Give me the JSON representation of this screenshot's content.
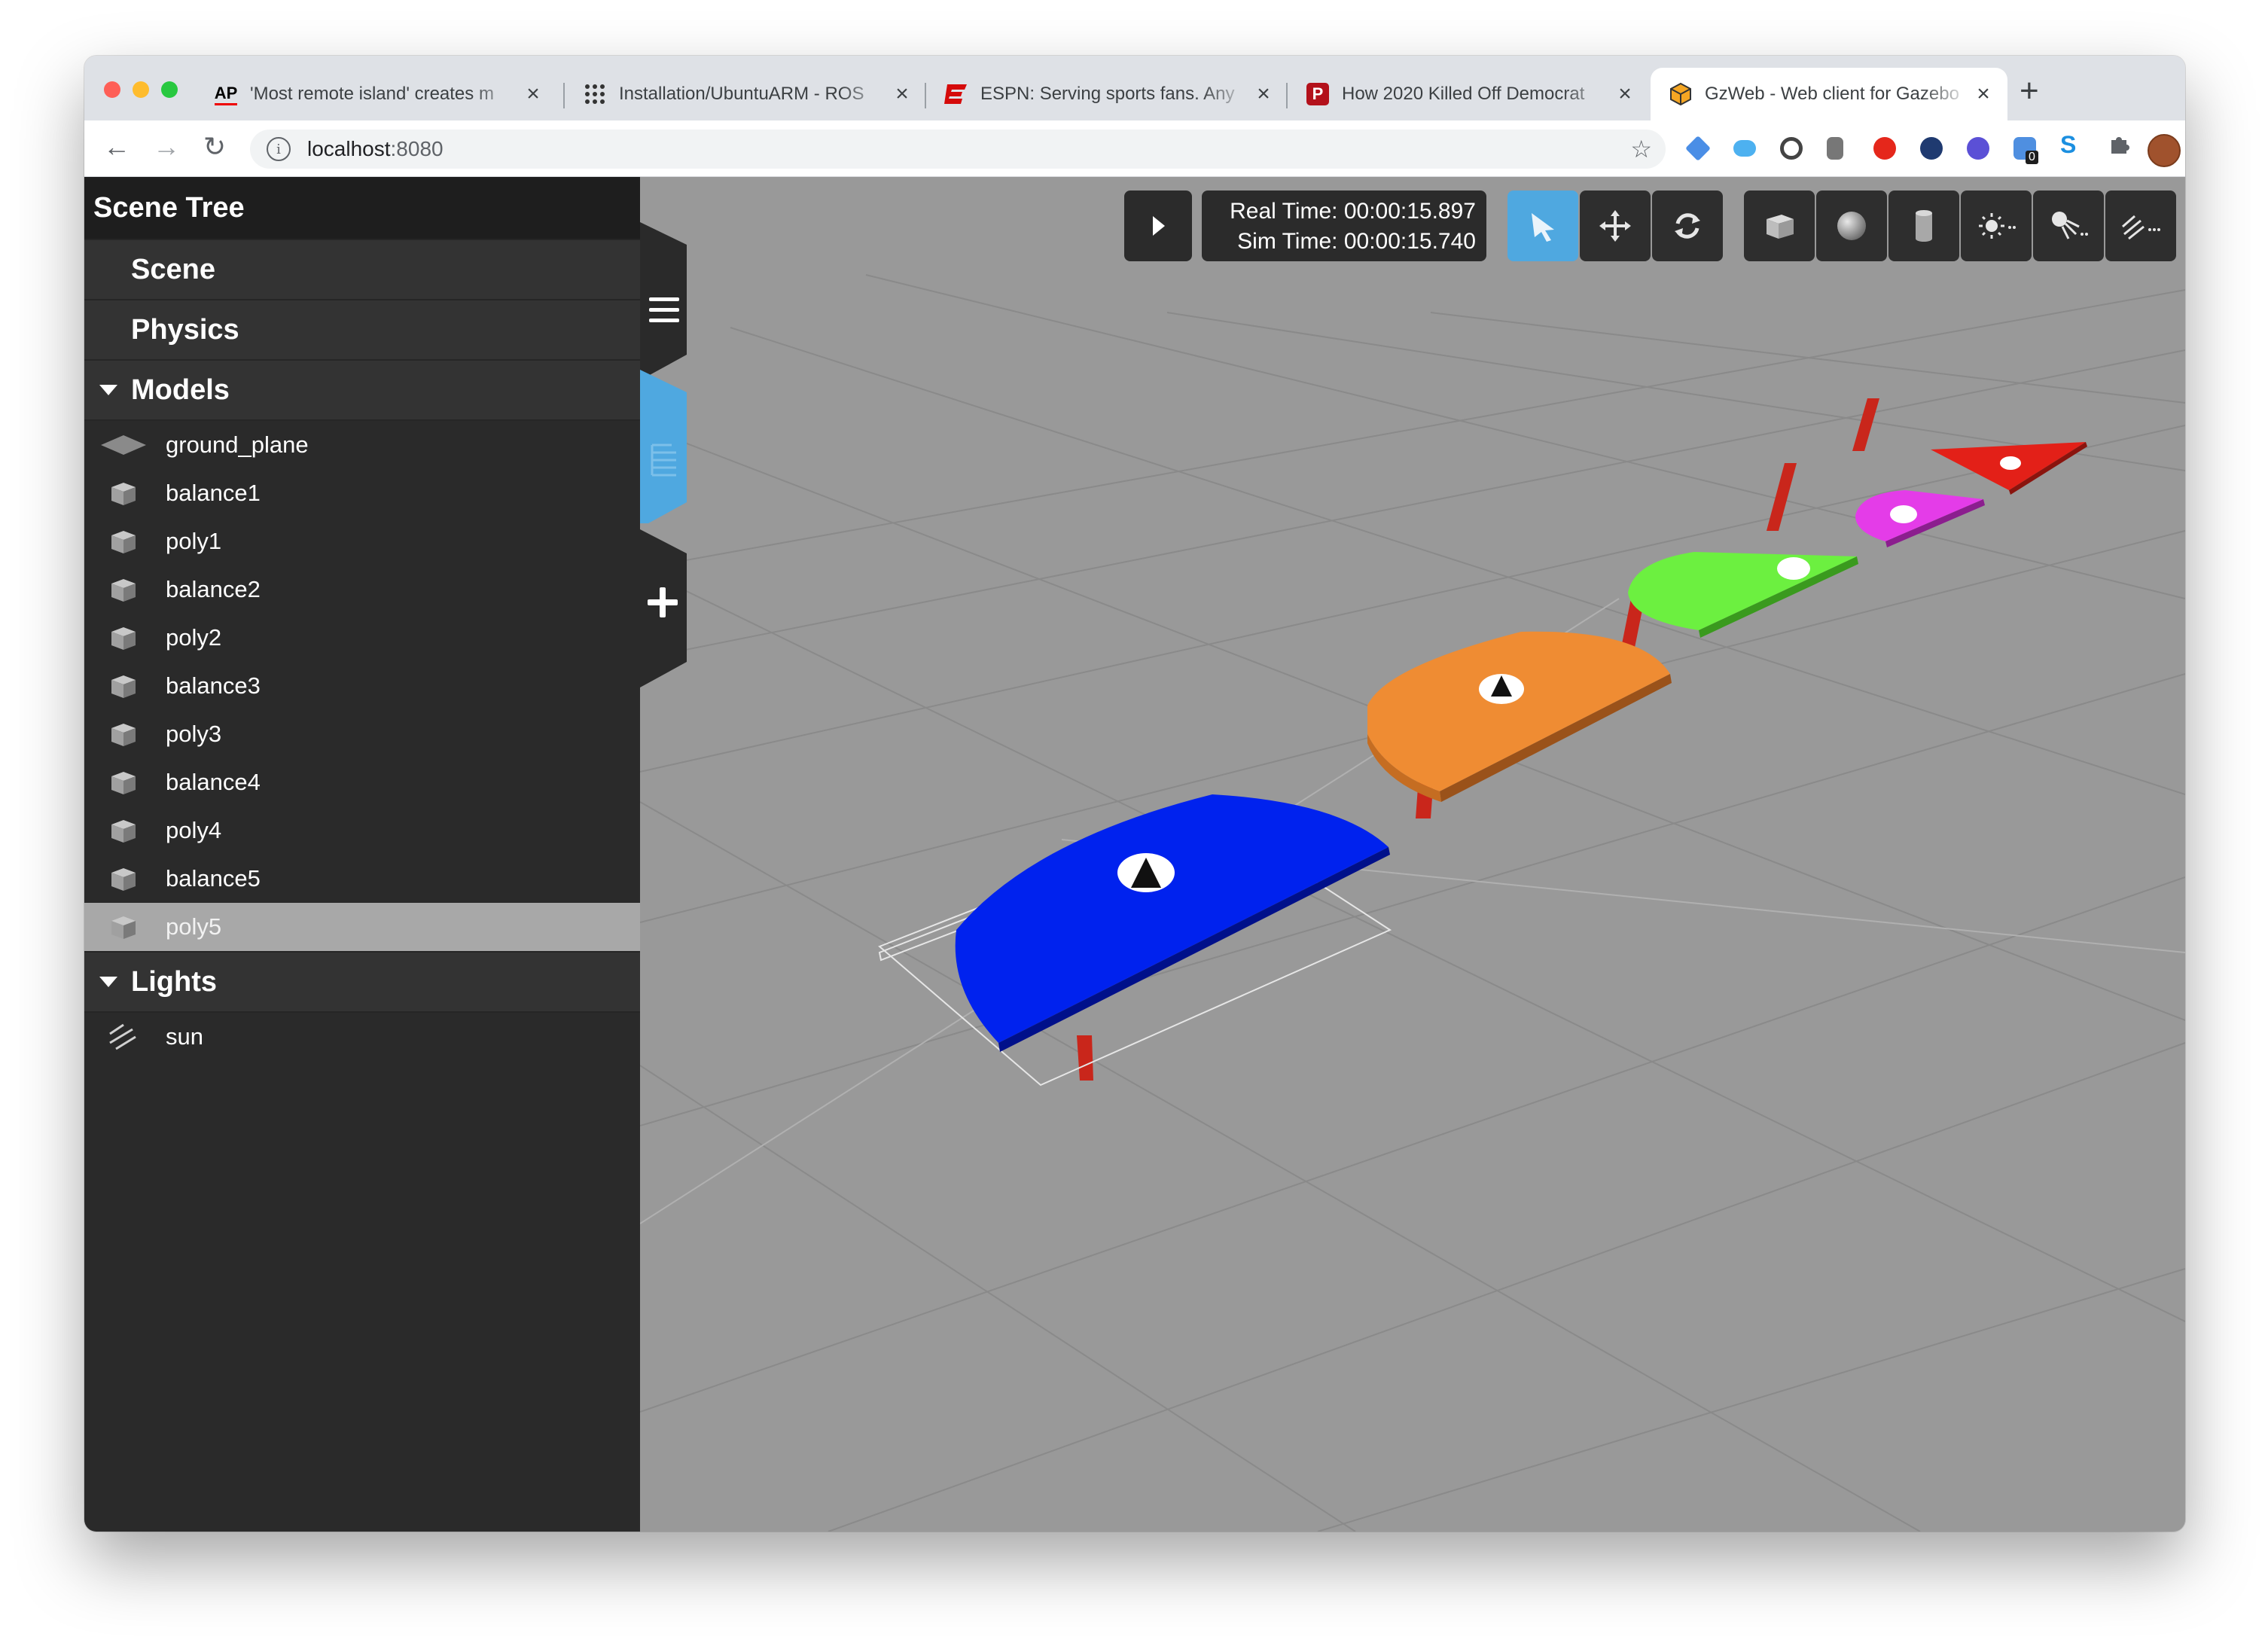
{
  "browser": {
    "tabs": [
      {
        "title": "'Most remote island' creates m",
        "favicon": "ap-icon",
        "active": false
      },
      {
        "title": "Installation/UbuntuARM - ROS",
        "favicon": "ros-grid-icon",
        "active": false
      },
      {
        "title": "ESPN: Serving sports fans. Any",
        "favicon": "espn-icon",
        "active": false
      },
      {
        "title": "How 2020 Killed Off Democrat",
        "favicon": "politico-icon",
        "active": false
      },
      {
        "title": "GzWeb - Web client for Gazebo",
        "favicon": "gazebo-icon",
        "active": true
      }
    ],
    "favicon_text": {
      "ap": "AP",
      "politico": "P"
    },
    "url_host": "localhost",
    "url_port": ":8080",
    "badge_count": "0"
  },
  "sidebar": {
    "title": "Scene Tree",
    "sections": [
      "Scene",
      "Physics"
    ],
    "models_label": "Models",
    "models": [
      {
        "label": "ground_plane",
        "icon": "plane-icon",
        "selected": false
      },
      {
        "label": "balance1",
        "icon": "box-icon",
        "selected": false
      },
      {
        "label": "poly1",
        "icon": "box-icon",
        "selected": false
      },
      {
        "label": "balance2",
        "icon": "box-icon",
        "selected": false
      },
      {
        "label": "poly2",
        "icon": "box-icon",
        "selected": false
      },
      {
        "label": "balance3",
        "icon": "box-icon",
        "selected": false
      },
      {
        "label": "poly3",
        "icon": "box-icon",
        "selected": false
      },
      {
        "label": "balance4",
        "icon": "box-icon",
        "selected": false
      },
      {
        "label": "poly4",
        "icon": "box-icon",
        "selected": false
      },
      {
        "label": "balance5",
        "icon": "box-icon",
        "selected": false
      },
      {
        "label": "poly5",
        "icon": "box-icon",
        "selected": true
      }
    ],
    "lights_label": "Lights",
    "lights": [
      {
        "label": "sun",
        "icon": "directional-light-icon"
      }
    ]
  },
  "toolbar": {
    "real_time": "Real Time: 00:00:15.897",
    "sim_time": "Sim Time: 00:00:15.740",
    "play_icon": "play-icon",
    "modes": [
      "select-mode-icon",
      "translate-mode-icon",
      "rotate-mode-icon"
    ],
    "shapes": [
      "box-shape-icon",
      "sphere-shape-icon",
      "cylinder-shape-icon",
      "point-light-icon",
      "spot-light-icon",
      "directional-light-icon"
    ]
  },
  "scene_colors": {
    "ground": "#999999",
    "platforms": [
      "#0022ee",
      "#ef8c33",
      "#6cf040",
      "#e43ce8",
      "#e32018"
    ],
    "posts": "#c9261b",
    "accent": "#4fa8e0"
  }
}
